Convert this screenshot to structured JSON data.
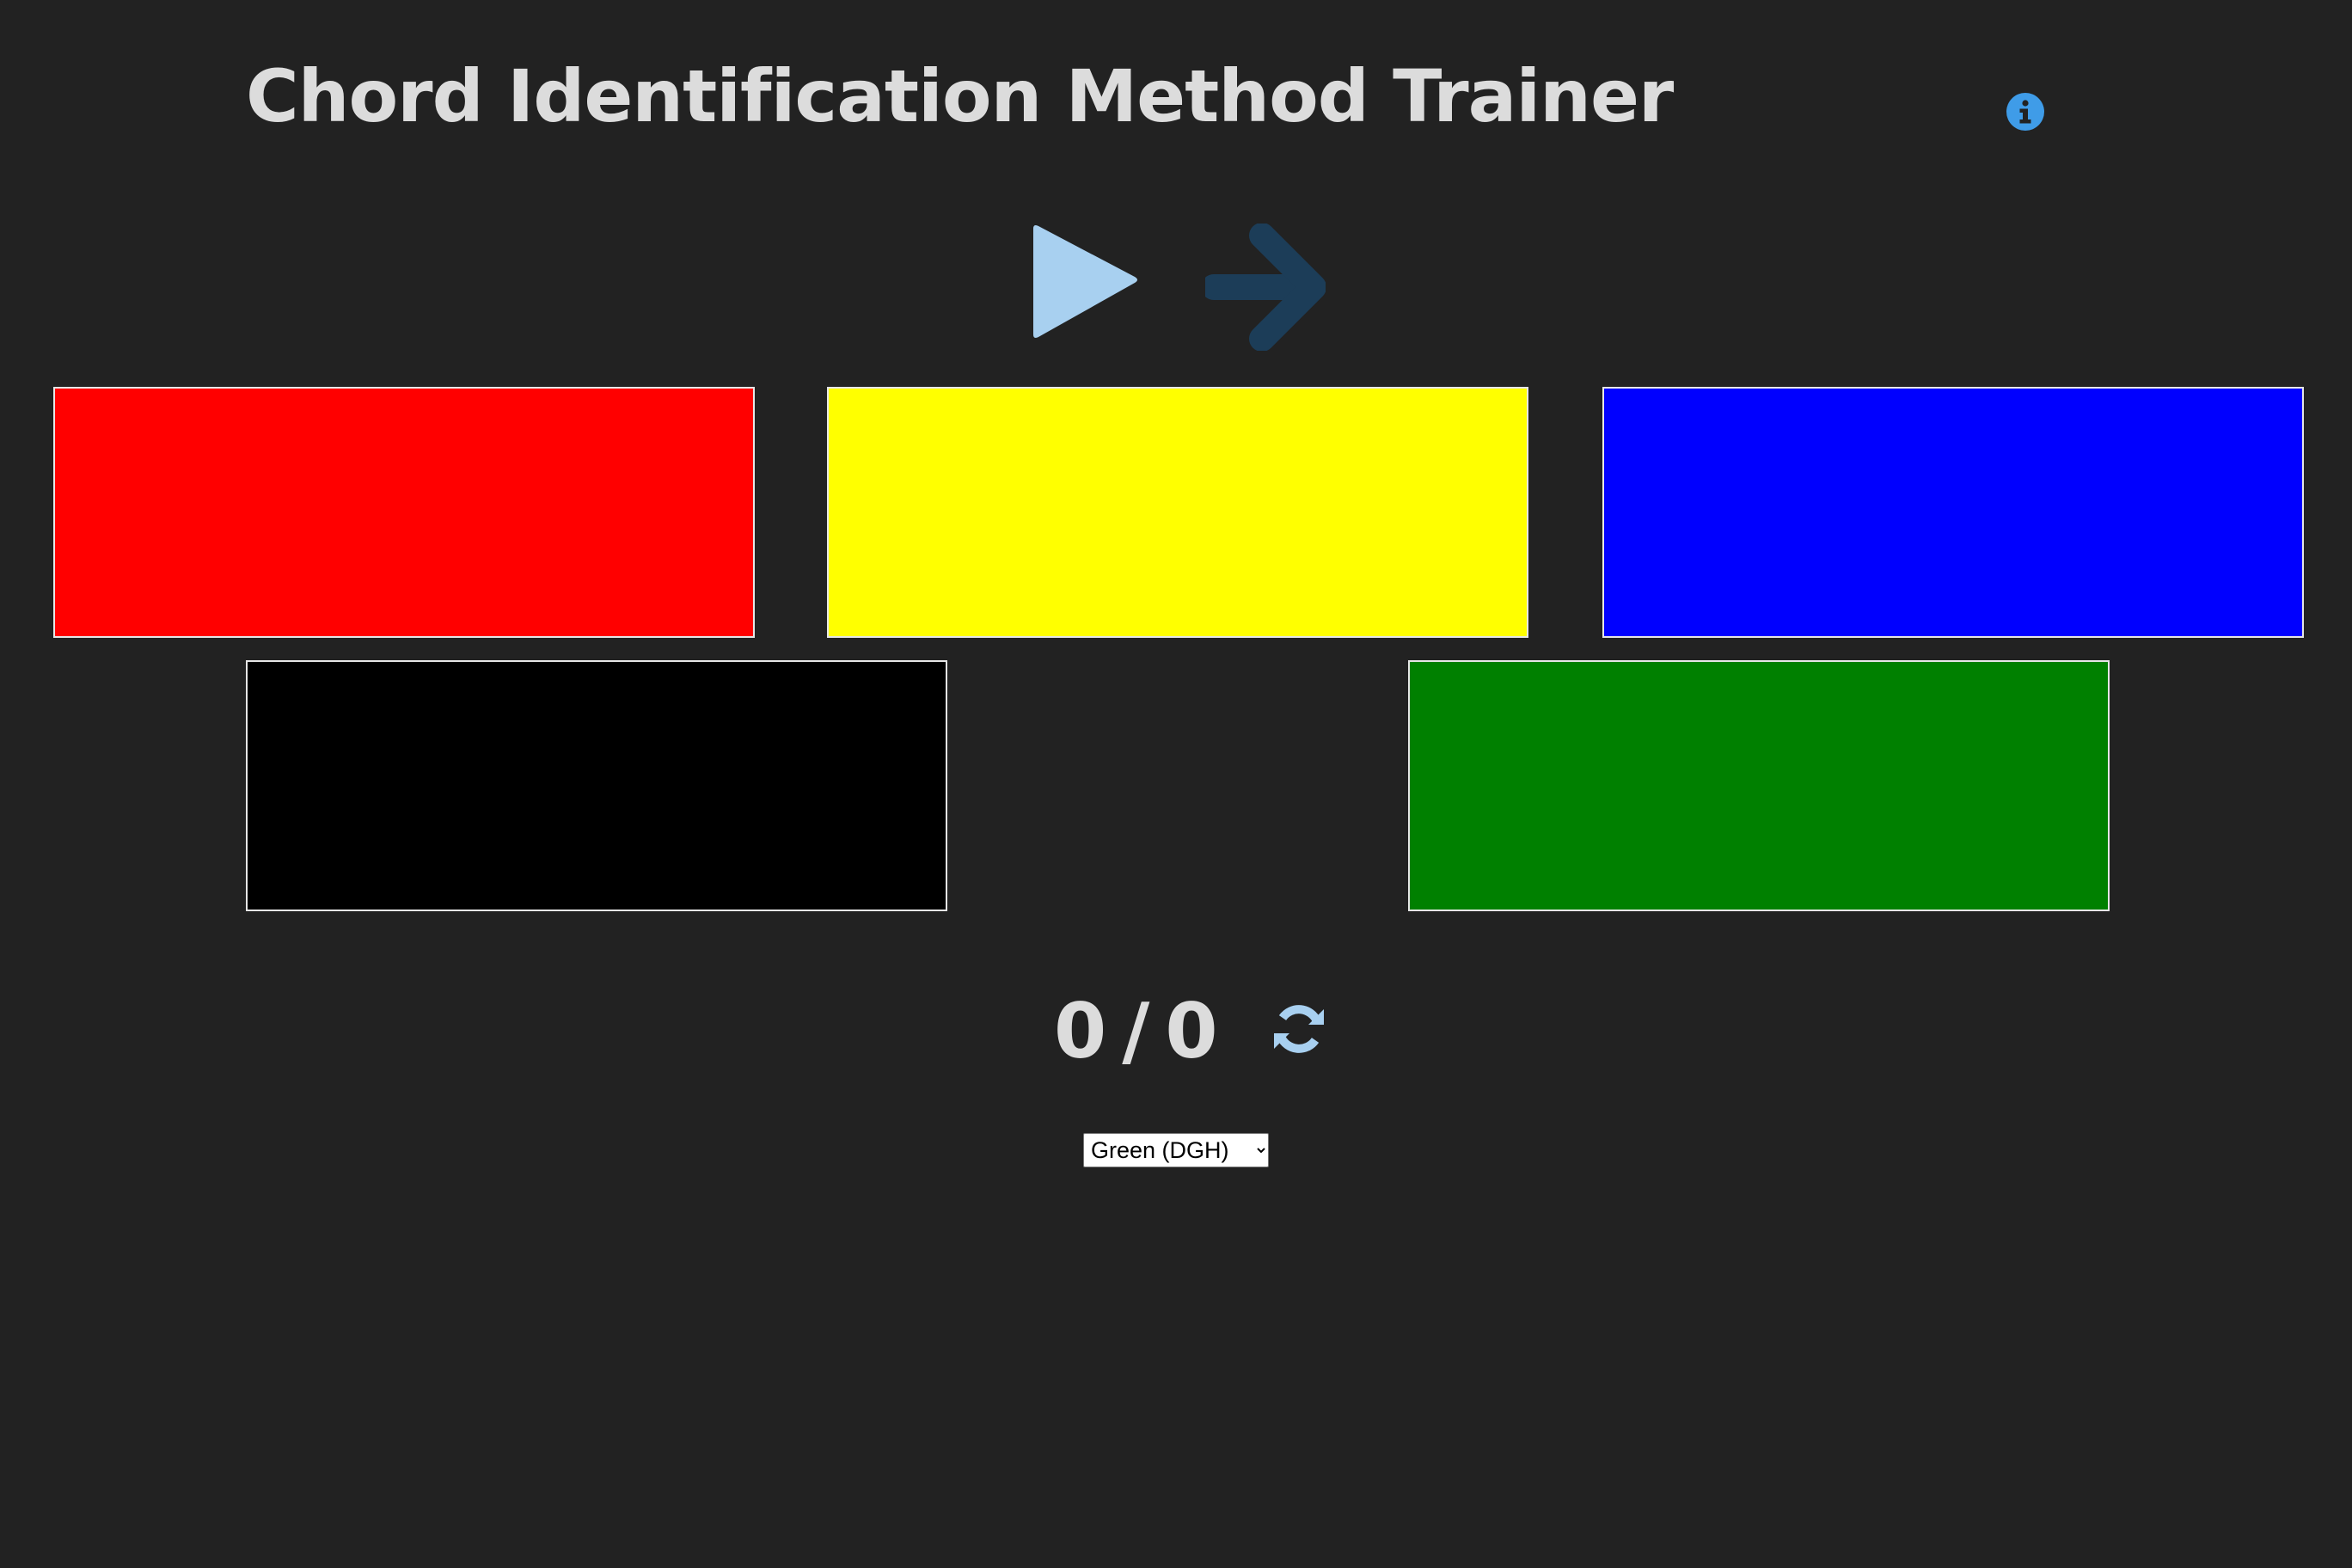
{
  "header": {
    "title": "Chord Identification Method Trainer",
    "info_icon": "info-circle-icon"
  },
  "controls": {
    "play_icon": "play-icon",
    "next_icon": "arrow-right-icon",
    "reset_icon": "refresh-icon"
  },
  "colors": {
    "background": "#222222",
    "text": "#dcdcdc",
    "info_accent": "#3f9ce8",
    "play": "#a8d0f0",
    "next": "#1c3d58",
    "refresh": "#a8d0f0"
  },
  "color_buttons": [
    {
      "name": "red",
      "color": "#ff0000"
    },
    {
      "name": "yellow",
      "color": "#ffff00"
    },
    {
      "name": "blue",
      "color": "#0000ff"
    },
    {
      "name": "black",
      "color": "#000000"
    },
    {
      "name": "green",
      "color": "#008000"
    }
  ],
  "score": {
    "correct": "0",
    "separator": "/",
    "total": "0"
  },
  "mode_select": {
    "selected": "Green (DGH)"
  }
}
